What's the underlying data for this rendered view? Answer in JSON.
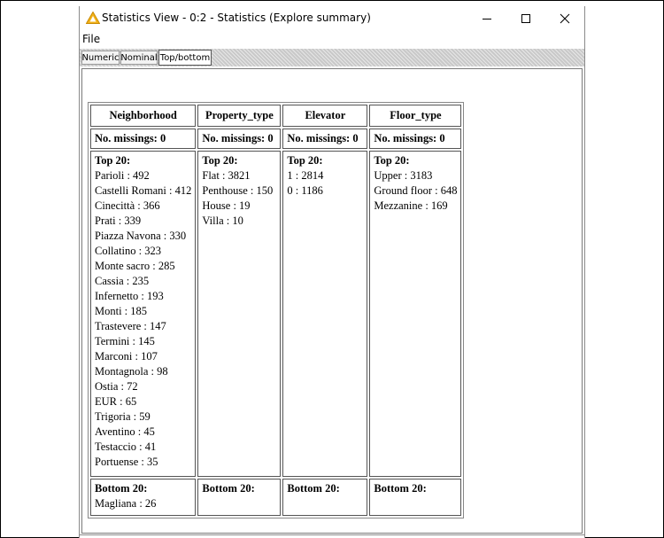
{
  "window": {
    "title": "Statistics View - 0:2 - Statistics (Explore summary)",
    "icon": "warning-triangle-icon",
    "controls": {
      "minimize": "—",
      "maximize": "☐",
      "close": "✕"
    }
  },
  "menu": {
    "file": "File"
  },
  "tabs": [
    {
      "label": "Numeric",
      "active": false
    },
    {
      "label": "Nominal",
      "active": false
    },
    {
      "label": "Top/bottom",
      "active": true
    }
  ],
  "table": {
    "columns": [
      {
        "header": "Neighborhood",
        "missing": "No. missings: 0",
        "top_label": "Top 20:",
        "top": [
          "Parioli : 492",
          "Castelli Romani : 412",
          "Cinecittà : 366",
          "Prati : 339",
          "Piazza Navona : 330",
          "Collatino : 323",
          "Monte sacro : 285",
          "Cassia : 235",
          "Infernetto : 193",
          "Monti : 185",
          "Trastevere : 147",
          "Termini : 145",
          "Marconi : 107",
          "Montagnola : 98",
          "Ostia : 72",
          "EUR : 65",
          "Trigoria : 59",
          "Aventino : 45",
          "Testaccio : 41",
          "Portuense : 35"
        ],
        "bottom_label": "Bottom 20:",
        "bottom": [
          "Magliana : 26"
        ]
      },
      {
        "header": "Property_type",
        "missing": "No. missings: 0",
        "top_label": "Top 20:",
        "top": [
          "Flat : 3821",
          "Penthouse : 150",
          "House : 19",
          "Villa : 10"
        ],
        "bottom_label": "Bottom 20:",
        "bottom": []
      },
      {
        "header": "Elevator",
        "missing": "No. missings: 0",
        "top_label": "Top 20:",
        "top": [
          "1 : 2814",
          "0 : 1186"
        ],
        "bottom_label": "Bottom 20:",
        "bottom": []
      },
      {
        "header": "Floor_type",
        "missing": "No. missings: 0",
        "top_label": "Top 20:",
        "top": [
          "Upper : 3183",
          "Ground floor : 648",
          "Mezzanine : 169"
        ],
        "bottom_label": "Bottom 20:",
        "bottom": []
      }
    ]
  }
}
